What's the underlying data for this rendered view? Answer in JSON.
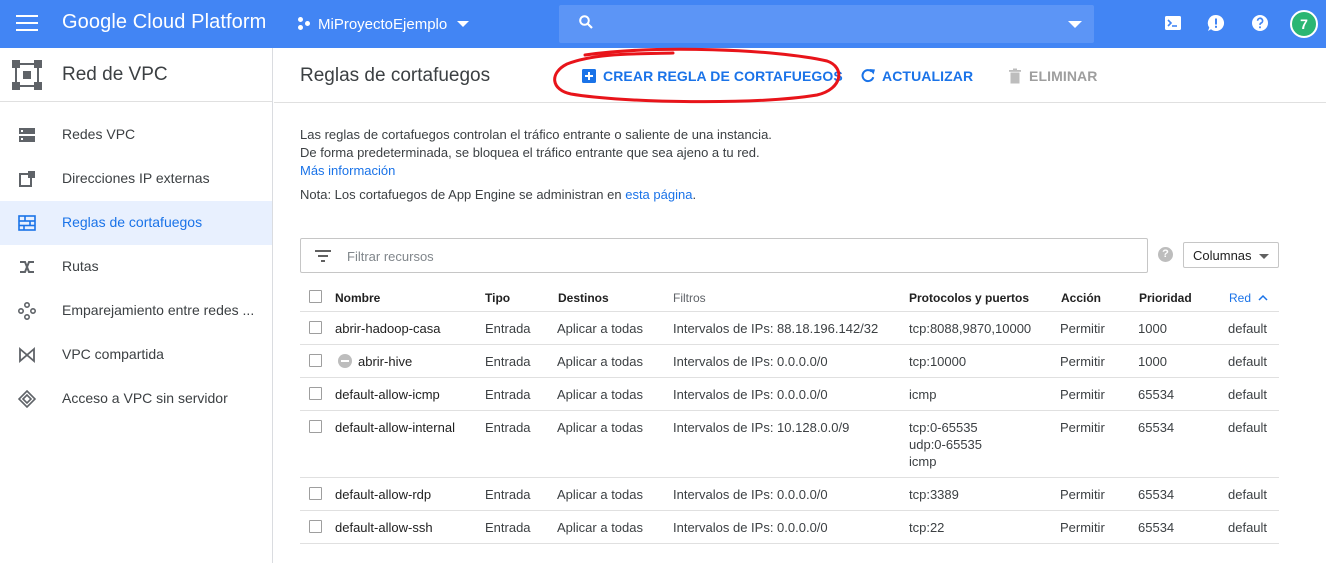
{
  "topbar": {
    "brand": "Google Cloud Platform",
    "project": "MiProyectoEjemplo",
    "search_placeholder": "",
    "avatar_letter": "7",
    "colors": {
      "bar": "#4285f4",
      "avatar": "#2bb673"
    },
    "icons": [
      "menu-icon",
      "project-icon",
      "search-icon",
      "cloud-shell-icon",
      "notifications-icon",
      "help-icon"
    ]
  },
  "sidebar": {
    "title": "Red de VPC",
    "items": [
      {
        "label": "Redes VPC",
        "icon": "vpc-networks-icon",
        "active": false
      },
      {
        "label": "Direcciones IP externas",
        "icon": "external-ip-icon",
        "active": false
      },
      {
        "label": "Reglas de cortafuegos",
        "icon": "firewall-icon",
        "active": true
      },
      {
        "label": "Rutas",
        "icon": "routes-icon",
        "active": false
      },
      {
        "label": "Emparejamiento entre redes ...",
        "icon": "peering-icon",
        "active": false
      },
      {
        "label": "VPC compartida",
        "icon": "shared-vpc-icon",
        "active": false
      },
      {
        "label": "Acceso a VPC sin servidor",
        "icon": "serverless-vpc-icon",
        "active": false
      }
    ]
  },
  "header": {
    "title": "Reglas de cortafuegos",
    "create_label": "CREAR REGLA DE CORTAFUEGOS",
    "refresh_label": "ACTUALIZAR",
    "delete_label": "ELIMINAR"
  },
  "info": {
    "line1": "Las reglas de cortafuegos controlan el tráfico entrante o saliente de una instancia.",
    "line2": "De forma predeterminada, se bloquea el tráfico entrante que sea ajeno a tu red.",
    "more_link": "Más información",
    "note_prefix": "Nota: Los cortafuegos de App Engine se administran en ",
    "note_link": "esta página",
    "note_suffix": "."
  },
  "filter": {
    "placeholder": "Filtrar recursos",
    "help": "?",
    "columns_label": "Columnas"
  },
  "table": {
    "headers": {
      "name": "Nombre",
      "type": "Tipo",
      "targets": "Destinos",
      "filters": "Filtros",
      "protocols": "Protocolos y puertos",
      "action": "Acción",
      "priority": "Prioridad",
      "network": "Red"
    },
    "rows": [
      {
        "name": "abrir-hadoop-casa",
        "type": "Entrada",
        "targets": "Aplicar a todas",
        "filters": "Intervalos de IPs: 88.18.196.142/32",
        "protocols": [
          "tcp:8088,9870,10000"
        ],
        "action": "Permitir",
        "priority": "1000",
        "network": "default",
        "disabled": false
      },
      {
        "name": "abrir-hive",
        "type": "Entrada",
        "targets": "Aplicar a todas",
        "filters": "Intervalos de IPs: 0.0.0.0/0",
        "protocols": [
          "tcp:10000"
        ],
        "action": "Permitir",
        "priority": "1000",
        "network": "default",
        "disabled": true
      },
      {
        "name": "default-allow-icmp",
        "type": "Entrada",
        "targets": "Aplicar a todas",
        "filters": "Intervalos de IPs: 0.0.0.0/0",
        "protocols": [
          "icmp"
        ],
        "action": "Permitir",
        "priority": "65534",
        "network": "default",
        "disabled": false
      },
      {
        "name": "default-allow-internal",
        "type": "Entrada",
        "targets": "Aplicar a todas",
        "filters": "Intervalos de IPs: 10.128.0.0/9",
        "protocols": [
          "tcp:0-65535",
          "udp:0-65535",
          "icmp"
        ],
        "action": "Permitir",
        "priority": "65534",
        "network": "default",
        "disabled": false
      },
      {
        "name": "default-allow-rdp",
        "type": "Entrada",
        "targets": "Aplicar a todas",
        "filters": "Intervalos de IPs: 0.0.0.0/0",
        "protocols": [
          "tcp:3389"
        ],
        "action": "Permitir",
        "priority": "65534",
        "network": "default",
        "disabled": false
      },
      {
        "name": "default-allow-ssh",
        "type": "Entrada",
        "targets": "Aplicar a todas",
        "filters": "Intervalos de IPs: 0.0.0.0/0",
        "protocols": [
          "tcp:22"
        ],
        "action": "Permitir",
        "priority": "65534",
        "network": "default",
        "disabled": false
      }
    ]
  }
}
